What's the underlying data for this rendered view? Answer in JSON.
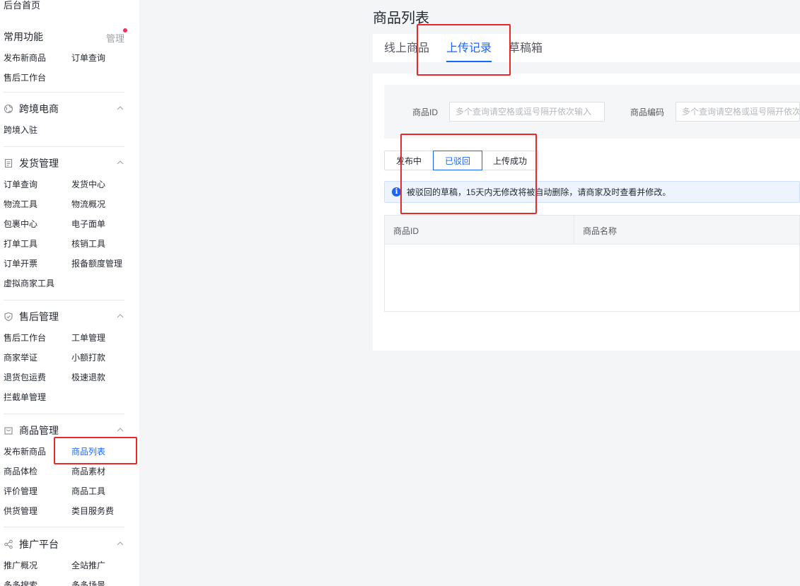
{
  "sidebar": {
    "top_link": "后台首页",
    "common": {
      "title": "常用功能",
      "manage": "管理",
      "items": [
        "发布新商品",
        "订单查询",
        "售后工作台"
      ]
    },
    "sections": [
      {
        "title": "跨境电商",
        "icon": "globe-icon",
        "items": [
          "跨境入驻"
        ]
      },
      {
        "title": "发货管理",
        "icon": "document-icon",
        "items": [
          "订单查询",
          "发货中心",
          "物流工具",
          "物流概况",
          "包裹中心",
          "电子面单",
          "打单工具",
          "核销工具",
          "订单开票",
          "报备额度管理",
          "虚拟商家工具"
        ]
      },
      {
        "title": "售后管理",
        "icon": "shield-icon",
        "items": [
          "售后工作台",
          "工单管理",
          "商家举证",
          "小额打款",
          "退货包运费",
          "极速退款",
          "拦截单管理"
        ]
      },
      {
        "title": "商品管理",
        "icon": "bag-icon",
        "items": [
          "发布新商品",
          "商品列表",
          "商品体检",
          "商品素材",
          "评价管理",
          "商品工具",
          "供货管理",
          "类目服务费"
        ]
      },
      {
        "title": "推广平台",
        "icon": "share-icon",
        "items": [
          "推广概况",
          "全站推广",
          "多多搜索",
          "多多场景"
        ]
      }
    ],
    "active_item": "商品列表"
  },
  "main": {
    "title": "商品列表",
    "tabs": [
      "线上商品",
      "上传记录",
      "草稿箱"
    ],
    "active_tab": "上传记录",
    "filters": [
      {
        "label": "商品ID",
        "placeholder": "多个查询请空格或逗号隔开依次输入"
      },
      {
        "label": "商品编码",
        "placeholder": "多个查询请空格或逗号隔开依次输入"
      }
    ],
    "status_segments": [
      "发布中",
      "已驳回",
      "上传成功"
    ],
    "active_segment": "已驳回",
    "alert": "被驳回的草稿，15天内无修改将被自动删除，请商家及时查看并修改。",
    "table": {
      "columns": [
        "商品ID",
        "商品名称"
      ]
    }
  },
  "colors": {
    "accent": "#1966ff",
    "annotation": "#e8282b",
    "badge": "#fe2c55"
  }
}
